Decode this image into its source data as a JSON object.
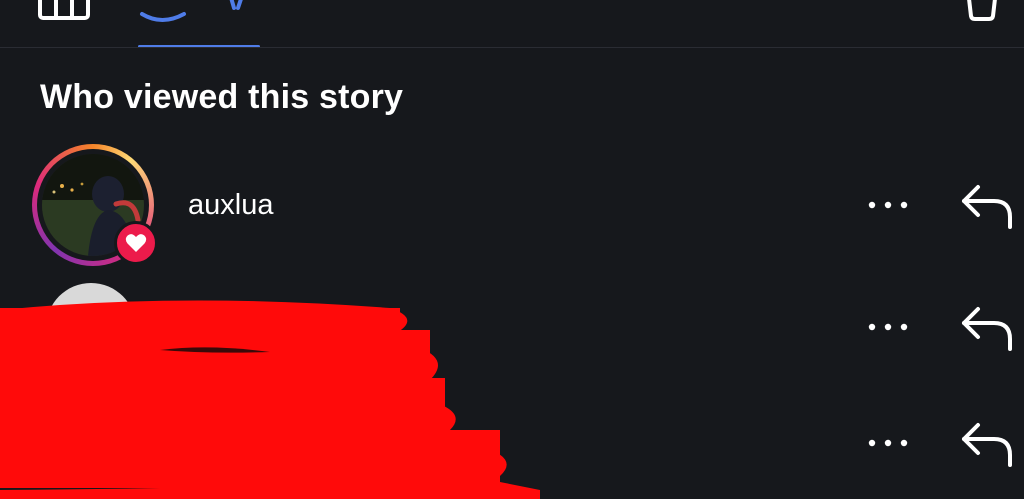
{
  "tabs": [
    {
      "icon": "bar-chart-icon"
    },
    {
      "icon": "viewers-icon",
      "active": true
    }
  ],
  "toolbar": {
    "delete_icon": "trash-icon"
  },
  "section": {
    "title": "Who viewed this story"
  },
  "viewers": [
    {
      "username": "auxlua",
      "reaction": "heart",
      "avatar": "photo",
      "story_ring": true
    },
    {
      "username": "",
      "avatar": "redacted"
    },
    {
      "username": "",
      "avatar": "redacted"
    }
  ],
  "colors": {
    "background": "#16181c",
    "accent_tab": "#4f7ce8",
    "like_badge": "#ec1b4b",
    "redaction": "#ff0a0a"
  }
}
